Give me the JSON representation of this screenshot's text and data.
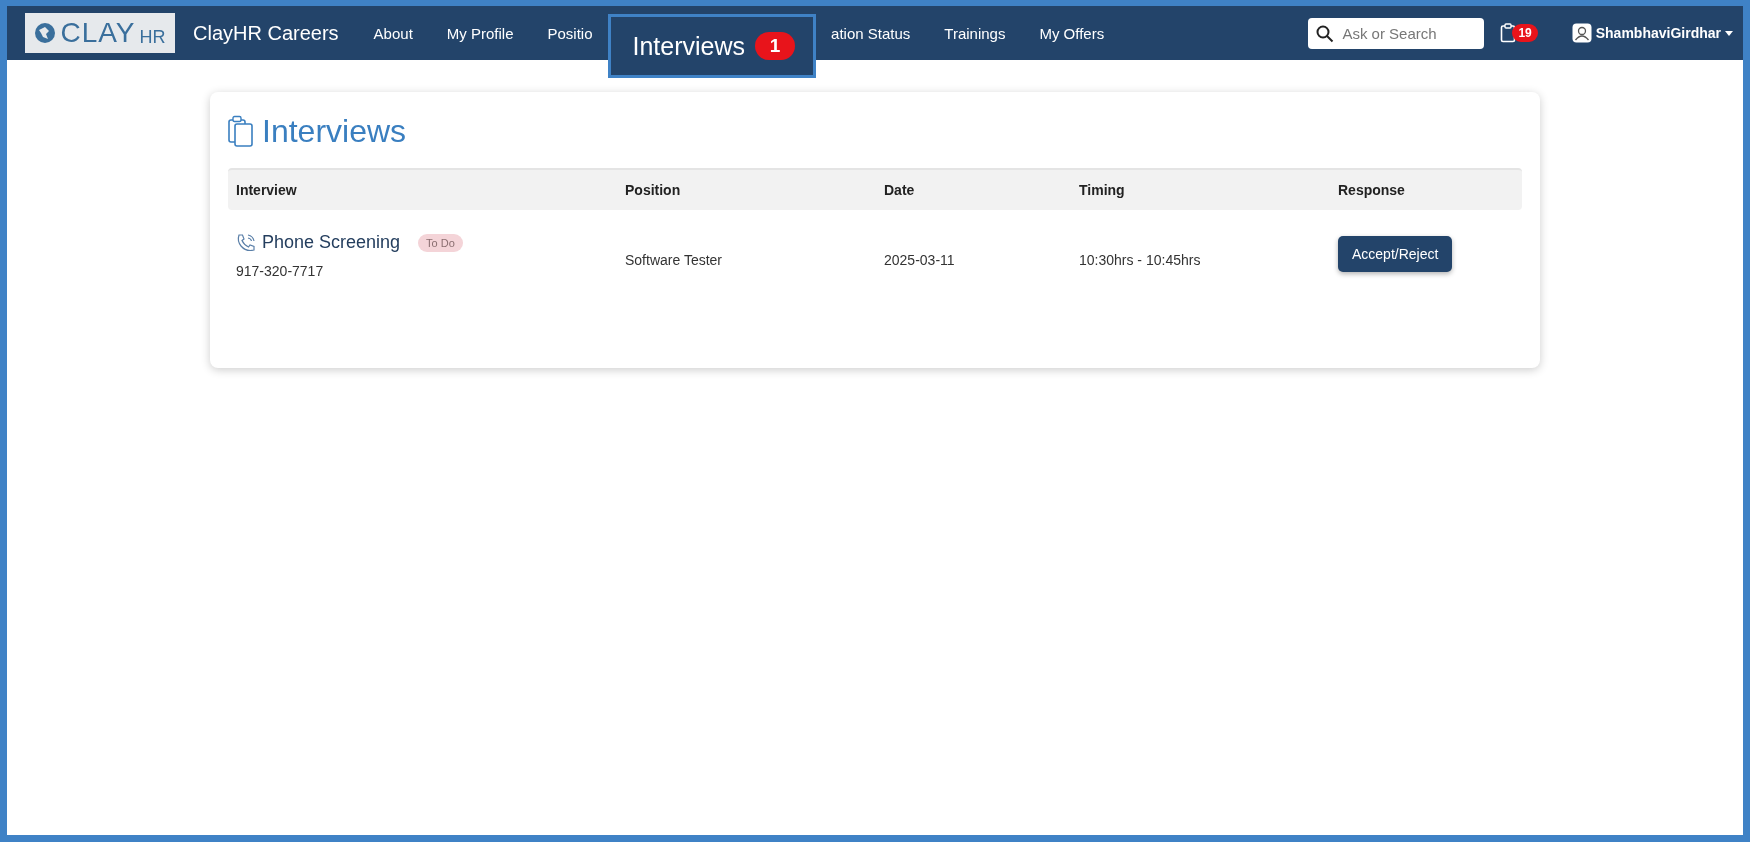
{
  "navbar": {
    "logo": {
      "main": "CLAY",
      "sub": "HR"
    },
    "brand": "ClayHR Careers",
    "items": [
      {
        "kind": "link",
        "label": "About"
      },
      {
        "kind": "link",
        "label": "My Profile"
      },
      {
        "kind": "link",
        "label": "Positio"
      },
      {
        "kind": "callout",
        "label": "Interviews",
        "badge": "1"
      },
      {
        "kind": "link",
        "label": "ation Status"
      },
      {
        "kind": "link",
        "label": "Trainings"
      },
      {
        "kind": "link",
        "label": "My Offers"
      }
    ],
    "search": {
      "placeholder": "Ask or Search"
    },
    "tasks_badge": "19",
    "user": "ShambhaviGirdhar"
  },
  "card": {
    "title": "Interviews",
    "table": {
      "columns": [
        "Interview",
        "Position",
        "Date",
        "Timing",
        "Response"
      ],
      "rows": [
        {
          "interview": "Phone Screening",
          "status": "To Do",
          "phone": "917-320-7717",
          "position": "Software Tester",
          "date": "2025-03-11",
          "timing": "10:30hrs - 10:45hrs",
          "action": "Accept/Reject"
        }
      ]
    }
  }
}
